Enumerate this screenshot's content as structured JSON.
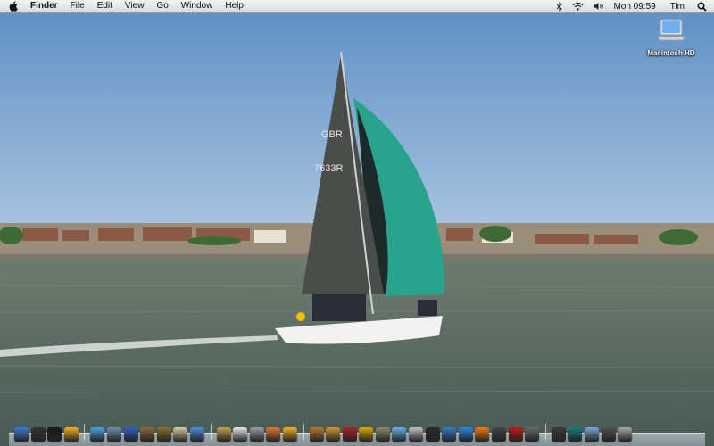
{
  "menubar": {
    "apple_icon": "apple-icon",
    "app_name": "Finder",
    "menus": [
      "File",
      "Edit",
      "View",
      "Go",
      "Window",
      "Help"
    ],
    "status_icons": [
      "bluetooth-icon",
      "wifi-icon",
      "volume-icon"
    ],
    "clock": "Mon 09:59",
    "user": "Tim",
    "spotlight_icon": "search-icon"
  },
  "desktop": {
    "hard_drive_label": "Macintosh HD",
    "hard_drive_icon": "laptop-drive-icon"
  },
  "dock": {
    "items_group1": [
      {
        "icon": "finder-icon",
        "color": "#3b7fd8"
      },
      {
        "icon": "dashboard-icon",
        "color": "#333333"
      },
      {
        "icon": "terminal-icon",
        "color": "#1a1a1a"
      },
      {
        "icon": "chat-icon",
        "color": "#f2b31c"
      }
    ],
    "items_group2": [
      {
        "icon": "safari-icon",
        "color": "#4aa3e8"
      },
      {
        "icon": "photo-icon",
        "color": "#6f8fb8"
      },
      {
        "icon": "user-icon",
        "color": "#3560c0"
      },
      {
        "icon": "photo-booth-icon",
        "color": "#8e6b3b"
      },
      {
        "icon": "mail-stamp-icon",
        "color": "#8a6f2a"
      },
      {
        "icon": "feather-icon",
        "color": "#d8c9a0"
      },
      {
        "icon": "ichat-icon",
        "color": "#4a90e2"
      }
    ],
    "items_group3": [
      {
        "icon": "notes-icon",
        "color": "#c8a24a"
      },
      {
        "icon": "calendar-icon",
        "color": "#e8e8e8"
      },
      {
        "icon": "sync-icon",
        "color": "#9aa0a8"
      },
      {
        "icon": "flower-icon",
        "color": "#e07830"
      },
      {
        "icon": "lock-icon",
        "color": "#f0b020"
      }
    ],
    "items_group4": [
      {
        "icon": "iphoto-icon",
        "color": "#b87a2a"
      },
      {
        "icon": "garageband-icon",
        "color": "#d09a30"
      },
      {
        "icon": "movie-icon",
        "color": "#b02020"
      },
      {
        "icon": "helmet-icon",
        "color": "#e0a800"
      },
      {
        "icon": "game-icon",
        "color": "#8a8a6a"
      },
      {
        "icon": "itunes-icon",
        "color": "#6ab0e8"
      },
      {
        "icon": "preview-icon",
        "color": "#c0c0c8"
      },
      {
        "icon": "screen-icon",
        "color": "#2b2b2b"
      },
      {
        "icon": "keynote-icon",
        "color": "#3a78c8"
      },
      {
        "icon": "globe-icon",
        "color": "#2a8ae0"
      },
      {
        "icon": "vlc-icon",
        "color": "#f07c10"
      },
      {
        "icon": "monitor-icon",
        "color": "#444444"
      },
      {
        "icon": "red-tool-icon",
        "color": "#c01818"
      },
      {
        "icon": "tools-icon",
        "color": "#6a6a6a"
      }
    ],
    "items_group5": [
      {
        "icon": "app-icon",
        "color": "#3a3a3a"
      },
      {
        "icon": "time-machine-icon",
        "color": "#1a7a7a"
      },
      {
        "icon": "folder-icon",
        "color": "#7aa8d8"
      },
      {
        "icon": "downloads-icon",
        "color": "#505050"
      },
      {
        "icon": "trash-icon",
        "color": "#a8a8a8"
      }
    ]
  }
}
